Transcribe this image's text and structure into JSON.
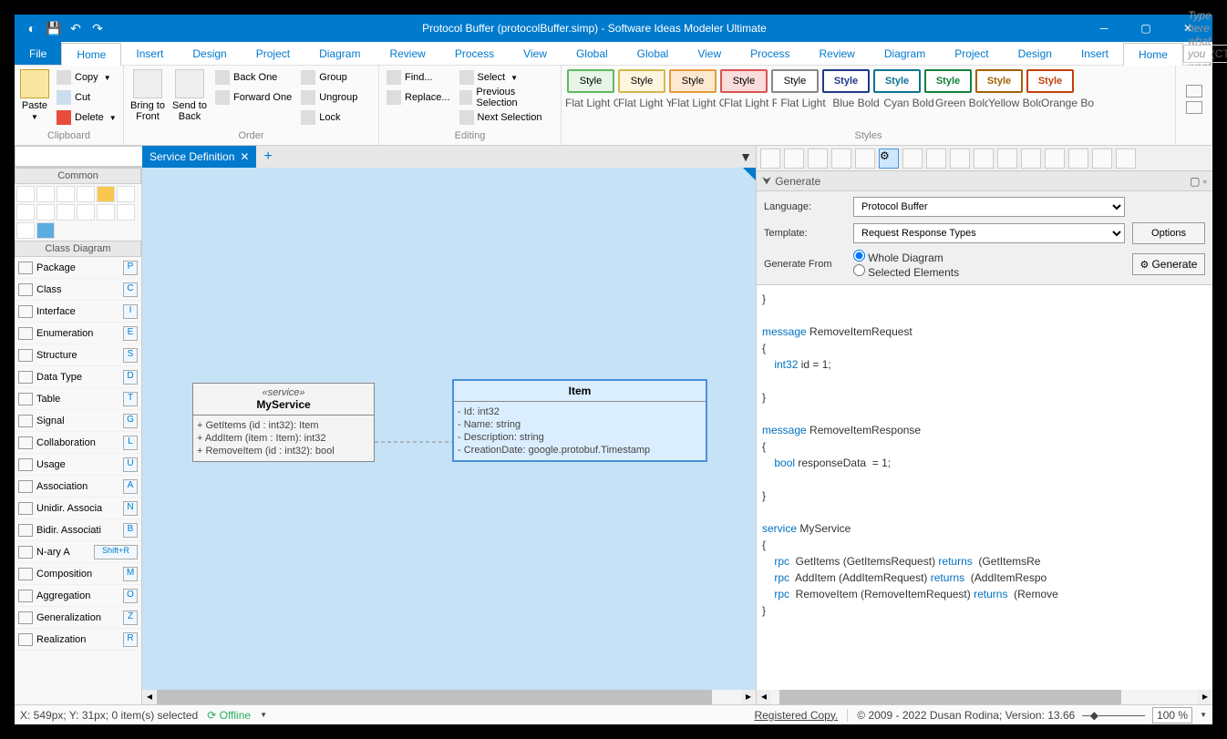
{
  "title": "Protocol Buffer (protocolBuffer.simp)  - Software Ideas Modeler Ultimate",
  "menubar": {
    "file": "File",
    "items": [
      "Home",
      "Insert",
      "Design",
      "Project",
      "Diagram",
      "Review",
      "Process",
      "View",
      "Global"
    ],
    "search_placeholder": "Type here what you want to do...",
    "search_hint": "(CTRL+Q)"
  },
  "ribbon": {
    "clipboard": {
      "label": "Clipboard",
      "paste": "Paste",
      "copy": "Copy",
      "cut": "Cut",
      "delete": "Delete"
    },
    "order": {
      "label": "Order",
      "bring": "Bring to\nFront",
      "send": "Send to\nBack",
      "back_one": "Back One",
      "forward_one": "Forward One",
      "group": "Group",
      "ungroup": "Ungroup",
      "lock": "Lock"
    },
    "editing": {
      "label": "Editing",
      "find": "Find...",
      "replace": "Replace...",
      "select": "Select",
      "prev": "Previous Selection",
      "next": "Next Selection"
    },
    "styles": {
      "label": "Styles",
      "items": [
        {
          "text": "Style",
          "border": "#5fb85f",
          "bg": "#e6f5e6",
          "name": "Flat Light G"
        },
        {
          "text": "Style",
          "border": "#d4b84e",
          "bg": "#fdf5dd",
          "name": "Flat Light Y"
        },
        {
          "text": "Style",
          "border": "#e69b3a",
          "bg": "#fde8d0",
          "name": "Flat Light O"
        },
        {
          "text": "Style",
          "border": "#d9534f",
          "bg": "#f9dcdc",
          "name": "Flat Light R"
        },
        {
          "text": "Style",
          "border": "#888",
          "bg": "#fff",
          "name": "Flat Light"
        },
        {
          "text": "Style",
          "border": "#1e3a8a",
          "bg": "#fff",
          "name": "Blue Bold",
          "bold": true
        },
        {
          "text": "Style",
          "border": "#0e7490",
          "bg": "#fff",
          "name": "Cyan Bold",
          "bold": true
        },
        {
          "text": "Style",
          "border": "#15803d",
          "bg": "#fff",
          "name": "Green Bold",
          "bold": true
        },
        {
          "text": "Style",
          "border": "#a16207",
          "bg": "#fff",
          "name": "Yellow Bold",
          "bold": true
        },
        {
          "text": "Style",
          "border": "#c2410c",
          "bg": "#fff",
          "name": "Orange Bol",
          "bold": true
        }
      ]
    }
  },
  "left": {
    "common": "Common",
    "classdiag": "Class Diagram",
    "items": [
      {
        "label": "Package",
        "key": "P"
      },
      {
        "label": "Class",
        "key": "C"
      },
      {
        "label": "Interface",
        "key": "I"
      },
      {
        "label": "Enumeration",
        "key": "E"
      },
      {
        "label": "Structure",
        "key": "S"
      },
      {
        "label": "Data Type",
        "key": "D"
      },
      {
        "label": "Table",
        "key": "T"
      },
      {
        "label": "Signal",
        "key": "G"
      },
      {
        "label": "Collaboration",
        "key": "L"
      },
      {
        "label": "Usage",
        "key": "U"
      },
      {
        "label": "Association",
        "key": "A"
      },
      {
        "label": "Unidir. Associa",
        "key": "N"
      },
      {
        "label": "Bidir. Associati",
        "key": "B"
      },
      {
        "label": "N-ary A",
        "key": "Shift+R"
      },
      {
        "label": "Composition",
        "key": "M"
      },
      {
        "label": "Aggregation",
        "key": "O"
      },
      {
        "label": "Generalization",
        "key": "Z"
      },
      {
        "label": "Realization",
        "key": "R"
      }
    ]
  },
  "doctab": {
    "label": "Service Definition"
  },
  "diagram": {
    "box1": {
      "stereo": "«service»",
      "name": "MyService",
      "ops": [
        "+ GetItems (id : int32): Item",
        "+ AddItem (item : Item): int32",
        "+ RemoveItem (id : int32): bool"
      ]
    },
    "box2": {
      "name": "Item",
      "attrs": [
        "- Id: int32",
        "- Name: string",
        "- Description: string",
        "- CreationDate: google.protobuf.Timestamp"
      ]
    }
  },
  "gen": {
    "title": "Generate",
    "lang_label": "Language:",
    "lang": "Protocol Buffer",
    "tpl_label": "Template:",
    "tpl": "Request Response Types",
    "from_label": "Generate From",
    "opt1": "Whole Diagram",
    "opt2": "Selected Elements",
    "options": "Options",
    "generate": "Generate"
  },
  "code": {
    "lines": [
      {
        "t": "}"
      },
      {
        "t": ""
      },
      {
        "segs": [
          {
            "k": "kw",
            "t": "message"
          },
          {
            "t": " RemoveItemRequest"
          }
        ]
      },
      {
        "t": "{"
      },
      {
        "segs": [
          {
            "t": "    "
          },
          {
            "k": "ty",
            "t": "int32"
          },
          {
            "t": " id = 1;"
          }
        ]
      },
      {
        "t": ""
      },
      {
        "t": "}"
      },
      {
        "t": ""
      },
      {
        "segs": [
          {
            "k": "kw",
            "t": "message"
          },
          {
            "t": " RemoveItemResponse"
          }
        ]
      },
      {
        "t": "{"
      },
      {
        "segs": [
          {
            "t": "    "
          },
          {
            "k": "ty",
            "t": "bool"
          },
          {
            "t": " responseData  = 1;"
          }
        ]
      },
      {
        "t": ""
      },
      {
        "t": "}"
      },
      {
        "t": ""
      },
      {
        "segs": [
          {
            "k": "kw",
            "t": "service"
          },
          {
            "t": " MyService"
          }
        ]
      },
      {
        "t": "{"
      },
      {
        "segs": [
          {
            "t": "    "
          },
          {
            "k": "kw",
            "t": "rpc"
          },
          {
            "t": "  GetItems (GetItemsRequest) "
          },
          {
            "k": "kw",
            "t": "returns"
          },
          {
            "t": "  (GetItemsRe"
          }
        ]
      },
      {
        "segs": [
          {
            "t": "    "
          },
          {
            "k": "kw",
            "t": "rpc"
          },
          {
            "t": "  AddItem (AddItemRequest) "
          },
          {
            "k": "kw",
            "t": "returns"
          },
          {
            "t": "  (AddItemRespo"
          }
        ]
      },
      {
        "segs": [
          {
            "t": "    "
          },
          {
            "k": "kw",
            "t": "rpc"
          },
          {
            "t": "  RemoveItem (RemoveItemRequest) "
          },
          {
            "k": "kw",
            "t": "returns"
          },
          {
            "t": "  (Remove"
          }
        ]
      },
      {
        "t": "}"
      }
    ]
  },
  "status": {
    "coords": "X: 549px; Y: 31px; 0 item(s) selected",
    "offline": "Offline",
    "reg": "Registered Copy.",
    "copy": "© 2009 - 2022 Dusan Rodina; Version: 13.66",
    "zoom": "100 %"
  }
}
